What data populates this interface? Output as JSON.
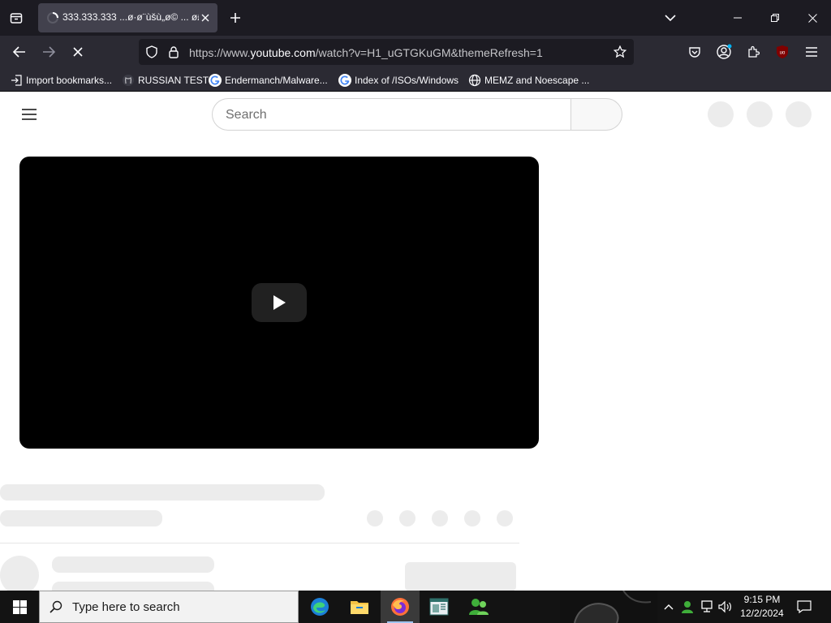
{
  "browser": {
    "tab": {
      "title": "333.333.333 ...ø·ø¨ùšù„ø© ... ø£ø"
    },
    "url": {
      "prefix": "https://www.",
      "host": "youtube.com",
      "path": "/watch?v=H1_uGTGKuGM&themeRefresh=1"
    },
    "bookmarks": [
      {
        "label": "Import bookmarks...",
        "icon": "import-icon"
      },
      {
        "label": "RUSSIAN TEST",
        "icon": "github-icon"
      },
      {
        "label": "Endermanch/Malware...",
        "icon": "google-icon"
      },
      {
        "label": "Index of /ISOs/Windows",
        "icon": "google-icon"
      },
      {
        "label": "MEMZ and Noescape ...",
        "icon": "globe-icon"
      }
    ]
  },
  "youtube": {
    "search": {
      "placeholder": "Search"
    }
  },
  "taskbar": {
    "search_text": "Type here to search",
    "time": "9:15 PM",
    "date": "12/2/2024",
    "apps": [
      "edge-icon",
      "file-explorer-icon",
      "firefox-icon",
      "document-app-icon",
      "people-app-icon"
    ]
  }
}
